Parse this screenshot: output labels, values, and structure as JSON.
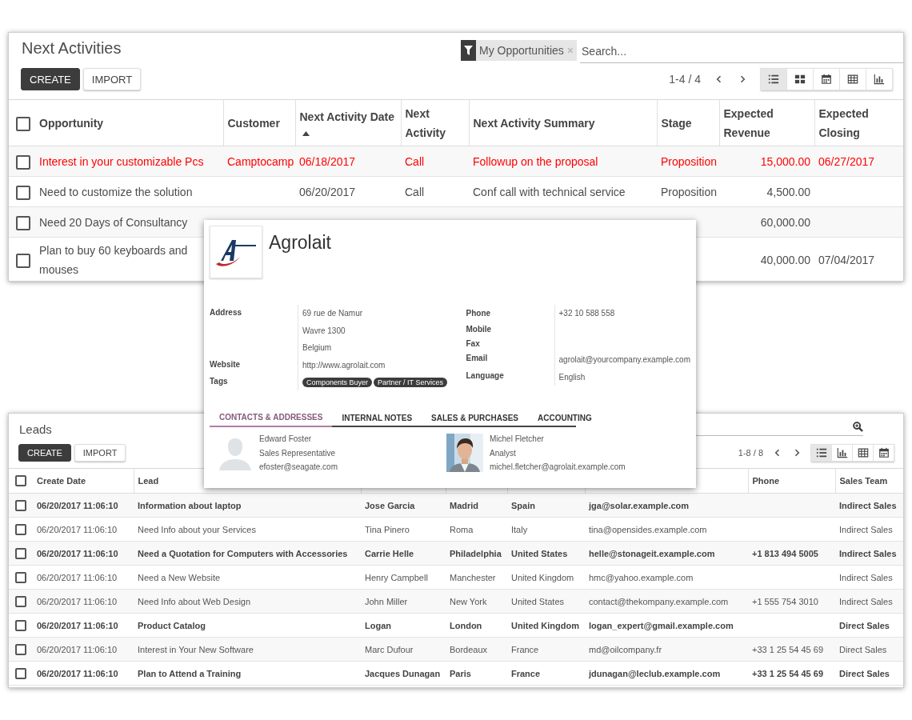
{
  "activities": {
    "title": "Next Activities",
    "buttons": [
      {
        "label": "CREATE",
        "kind": "primary"
      },
      {
        "label": "IMPORT",
        "kind": "secondary"
      }
    ],
    "search": {
      "facet": "My Opportunities",
      "remove": "×",
      "placeholder": "Search..."
    },
    "pager": "1-4 / 4",
    "select_all_checked": false,
    "views": [
      {
        "kind": "list",
        "selected": true
      },
      {
        "kind": "kanban",
        "selected": false
      },
      {
        "kind": "calendar",
        "selected": false
      },
      {
        "kind": "pivot",
        "selected": false
      },
      {
        "kind": "graph",
        "selected": false
      }
    ],
    "columns": [
      {
        "label": "Opportunity"
      },
      {
        "label": "Customer"
      },
      {
        "label": "Next Activity Date",
        "sorted": true
      },
      {
        "label": "Next Activity"
      },
      {
        "label": "Next Activity Summary"
      },
      {
        "label": "Stage"
      },
      {
        "label": "Expected Revenue"
      },
      {
        "label": "Expected Closing"
      }
    ],
    "rows": [
      {
        "opportunity": "Interest in your customizable Pcs",
        "customer": "Camptocamp",
        "date": "06/18/2017",
        "activity": "Call",
        "summary": "Followup on the proposal",
        "stage": "Proposition",
        "revenue": "15,000.00",
        "closing": "06/27/2017",
        "overdue": true,
        "checked": false
      },
      {
        "opportunity": "Need to customize the solution",
        "date": "06/20/2017",
        "activity": "Call",
        "summary": "Conf call with technical service",
        "stage": "Proposition",
        "revenue": "4,500.00",
        "overdue": false,
        "checked": false
      },
      {
        "opportunity": "Need 20 Days of Consultancy",
        "revenue": "60,000.00",
        "overdue": false,
        "checked": false
      },
      {
        "opportunity": "Plan to buy 60 keyboards and mouses",
        "revenue": "40,000.00",
        "closing": "07/04/2017",
        "overdue": false,
        "checked": false
      }
    ]
  },
  "leads": {
    "title": "Leads",
    "buttons": [
      {
        "label": "CREATE",
        "kind": "primary"
      },
      {
        "label": "IMPORT",
        "kind": "secondary"
      }
    ],
    "pager": "1-8 / 8",
    "select_all_checked": false,
    "views": [
      {
        "kind": "list",
        "selected": true
      },
      {
        "kind": "graph",
        "selected": false
      },
      {
        "kind": "pivot",
        "selected": false
      },
      {
        "kind": "calendar",
        "selected": false
      }
    ],
    "columns": [
      {
        "label": "Create Date"
      },
      {
        "label": "Lead"
      },
      {
        "label": "Phone"
      },
      {
        "label": "Sales Team"
      }
    ],
    "rows": [
      {
        "create_date": "06/20/2017 11:06:10",
        "lead": "Information about laptop",
        "contact": "Jose Garcia",
        "city": "Madrid",
        "country": "Spain",
        "email": "jga@solar.example.com",
        "sales_team": "Indirect Sales",
        "unread": true,
        "checked": false
      },
      {
        "create_date": "06/20/2017 11:06:10",
        "lead": "Need Info about your Services",
        "contact": "Tina Pinero",
        "city": "Roma",
        "country": "Italy",
        "email": "tina@opensides.example.com",
        "sales_team": "Indirect Sales",
        "unread": false,
        "checked": false
      },
      {
        "create_date": "06/20/2017 11:06:10",
        "lead": "Need a Quotation for Computers with Accessories",
        "contact": "Carrie Helle",
        "city": "Philadelphia",
        "country": "United States",
        "email": "helle@stonageit.example.com",
        "phone": "+1 813 494 5005",
        "sales_team": "Indirect Sales",
        "unread": true,
        "checked": false
      },
      {
        "create_date": "06/20/2017 11:06:10",
        "lead": "Need a New Website",
        "contact": "Henry Campbell",
        "city": "Manchester",
        "country": "United Kingdom",
        "email": "hmc@yahoo.example.com",
        "sales_team": "Indirect Sales",
        "unread": false,
        "checked": false
      },
      {
        "create_date": "06/20/2017 11:06:10",
        "lead": "Need Info about Web Design",
        "contact": "John Miller",
        "city": "New York",
        "country": "United States",
        "email": "contact@thekompany.example.com",
        "phone": "+1 555 754 3010",
        "sales_team": "Indirect Sales",
        "unread": false,
        "checked": false
      },
      {
        "create_date": "06/20/2017 11:06:10",
        "lead": "Product Catalog",
        "contact": "Logan",
        "city": "London",
        "country": "United Kingdom",
        "email": "logan_expert@gmail.example.com",
        "sales_team": "Direct Sales",
        "unread": true,
        "checked": false
      },
      {
        "create_date": "06/20/2017 11:06:10",
        "lead": "Interest in Your New Software",
        "contact": "Marc Dufour",
        "city": "Bordeaux",
        "country": "France",
        "email": "md@oilcompany.fr",
        "phone": "+33 1 25 54 45 69",
        "sales_team": "Direct Sales",
        "unread": false,
        "checked": false
      },
      {
        "create_date": "06/20/2017 11:06:10",
        "lead": "Plan to Attend a Training",
        "contact": "Jacques Dunagan",
        "city": "Paris",
        "country": "France",
        "email": "jdunagan@leclub.example.com",
        "phone": "+33 1 25 54 45 69",
        "sales_team": "Direct Sales",
        "unread": true,
        "checked": false
      }
    ]
  },
  "partner_card": {
    "name": "Agrolait",
    "left_fields": [
      {
        "label": "Address",
        "lines": [
          "69 rue de Namur",
          "Wavre  1300",
          "Belgium"
        ]
      },
      {
        "label": "Website",
        "lines": [
          "http://www.agrolait.com"
        ]
      },
      {
        "label": "Tags",
        "tags": [
          "Components Buyer",
          "Partner / IT Services"
        ]
      }
    ],
    "right_fields": [
      {
        "label": "Phone",
        "lines": [
          "+32 10 588 558"
        ]
      },
      {
        "label": "Mobile"
      },
      {
        "label": "Fax"
      },
      {
        "label": "Email",
        "lines": [
          "agrolait@yourcompany.example.com"
        ]
      },
      {
        "label": "Language",
        "lines": [
          "English"
        ]
      }
    ],
    "tabs": [
      {
        "label": "CONTACTS & ADDRESSES",
        "selected": true
      },
      {
        "label": "INTERNAL NOTES",
        "selected": false
      },
      {
        "label": "SALES & PURCHASES",
        "selected": false
      },
      {
        "label": "ACCOUNTING",
        "selected": false
      }
    ],
    "contacts": [
      {
        "name": "Edward Foster",
        "function": "Sales Representative",
        "email": "efoster@seagate.com",
        "kind": "placeholder"
      },
      {
        "name": "Michel Fletcher",
        "function": "Analyst",
        "email": "michel.fletcher@agrolait.example.com"
      }
    ]
  }
}
